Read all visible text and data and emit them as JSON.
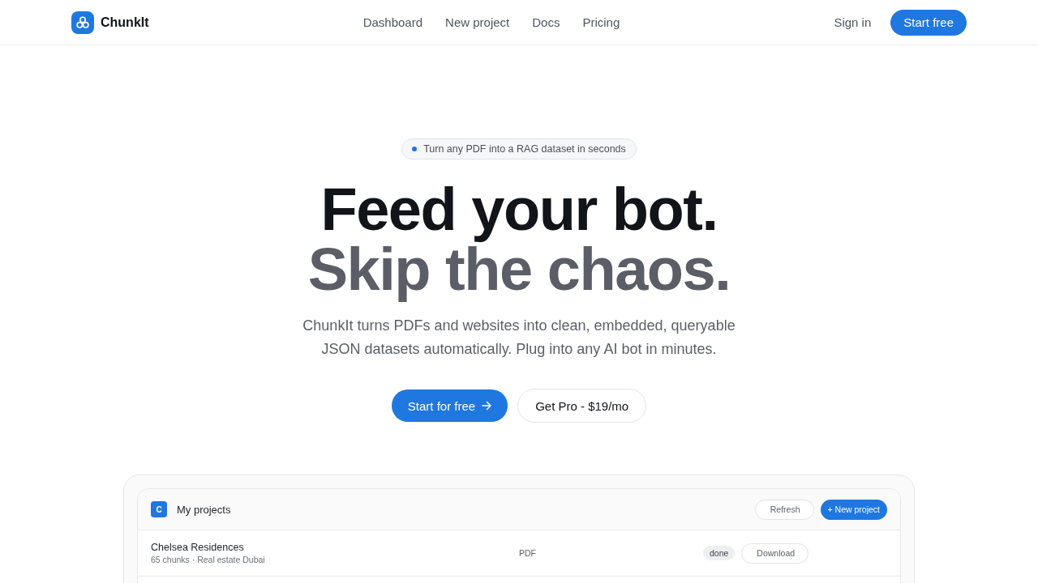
{
  "nav": {
    "brand": "ChunkIt",
    "links": [
      {
        "label": "Dashboard"
      },
      {
        "label": "New project"
      },
      {
        "label": "Docs"
      },
      {
        "label": "Pricing"
      }
    ],
    "sign_in": "Sign in",
    "cta": "Start free"
  },
  "hero": {
    "badge": "Turn any PDF into a RAG dataset in seconds",
    "headline_1": "Feed your bot.",
    "headline_2": "Skip the chaos.",
    "lead": "ChunkIt turns PDFs and websites into clean, embedded, queryable JSON datasets automatically. Plug into any AI bot in minutes.",
    "primary_button": "Start for free",
    "secondary_button": "Get Pro - $19/mo"
  },
  "preview": {
    "avatar": "C",
    "title": "My projects",
    "buttons": [
      {
        "label": "Refresh",
        "kind": "outline"
      },
      {
        "label": "+ New project",
        "kind": "primary"
      }
    ],
    "projects": [
      {
        "name": "Chelsea Residences",
        "meta": "65 chunks · Real estate Dubai",
        "type": "PDF",
        "status": "done",
        "action": "Download"
      }
    ]
  }
}
